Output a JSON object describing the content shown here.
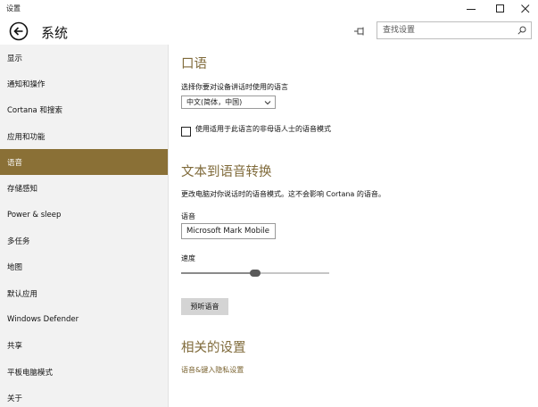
{
  "window": {
    "app_title": "设置"
  },
  "header": {
    "page_title": "系统",
    "search_placeholder": "查找设置"
  },
  "sidebar": {
    "items": [
      {
        "label": "显示",
        "active": false
      },
      {
        "label": "通知和操作",
        "active": false
      },
      {
        "label": "Cortana 和搜索",
        "active": false
      },
      {
        "label": "应用和功能",
        "active": false
      },
      {
        "label": "语音",
        "active": true
      },
      {
        "label": "存储感知",
        "active": false
      },
      {
        "label": "Power & sleep",
        "active": false
      },
      {
        "label": "多任务",
        "active": false
      },
      {
        "label": "地图",
        "active": false
      },
      {
        "label": "默认应用",
        "active": false
      },
      {
        "label": "Windows Defender",
        "active": false
      },
      {
        "label": "共享",
        "active": false
      },
      {
        "label": "平板电脑模式",
        "active": false
      },
      {
        "label": "关于",
        "active": false
      }
    ]
  },
  "speech": {
    "title": "口语",
    "language_prompt": "选择你要对设备讲话时使用的语言",
    "language_value": "中文(简体，中国)",
    "non_native_label": "使用适用于此语言的非母语人士的语音模式",
    "non_native_checked": false
  },
  "tts": {
    "title": "文本到语音转换",
    "description": "更改电脑对你说话时的语音模式。这不会影响 Cortana 的语音。",
    "voice_label": "语音",
    "voice_value": "Microsoft Mark Mobile",
    "speed_label": "速度",
    "speed_fraction": 0.5,
    "preview_button": "预听语音"
  },
  "related": {
    "title": "相关的设置",
    "privacy_link": "语音&键入隐私设置"
  },
  "colors": {
    "accent": "#8a7036",
    "sidebar_bg": "#f2f2f2",
    "section_title": "#7f6a3a",
    "link": "#7a6330"
  }
}
